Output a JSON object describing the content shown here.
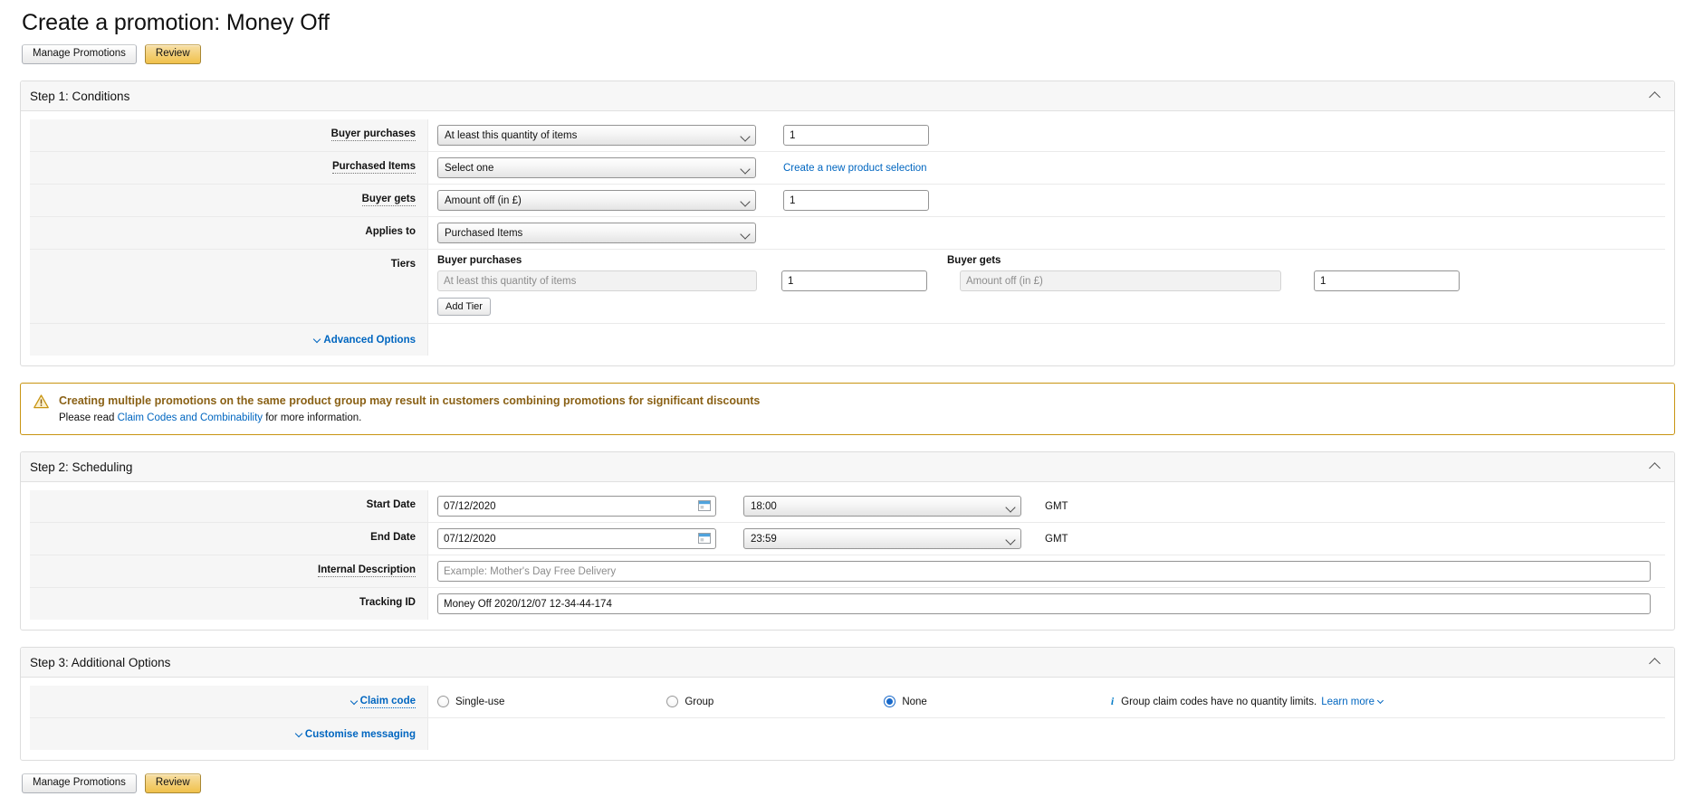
{
  "page": {
    "title": "Create a promotion: Money Off"
  },
  "toolbar": {
    "manage_label": "Manage Promotions",
    "review_label": "Review"
  },
  "step1": {
    "header": "Step 1: Conditions",
    "rows": {
      "buyer_purchases": {
        "label": "Buyer purchases",
        "select_value": "At least this quantity of items",
        "qty_value": "1"
      },
      "purchased_items": {
        "label": "Purchased Items",
        "select_value": "Select one",
        "link": "Create a new product selection"
      },
      "buyer_gets": {
        "label": "Buyer gets",
        "select_value": "Amount off (in £)",
        "qty_value": "1"
      },
      "applies_to": {
        "label": "Applies to",
        "select_value": "Purchased Items"
      },
      "tiers": {
        "label": "Tiers",
        "head_left": "Buyer purchases",
        "head_right": "Buyer gets",
        "left_placeholder": "At least this quantity of items",
        "left_qty": "1",
        "right_placeholder": "Amount off (in £)",
        "right_qty": "1",
        "add_tier_label": "Add Tier"
      },
      "advanced": {
        "label": "Advanced Options"
      }
    }
  },
  "warning": {
    "icon": "warning-triangle-icon",
    "title": "Creating multiple promotions on the same product group may result in customers combining promotions for significant discounts",
    "text_before": "Please read ",
    "link": "Claim Codes and Combinability",
    "text_after": " for more information."
  },
  "step2": {
    "header": "Step 2: Scheduling",
    "rows": {
      "start_date": {
        "label": "Start Date",
        "date_value": "07/12/2020",
        "time_value": "18:00",
        "timezone": "GMT"
      },
      "end_date": {
        "label": "End Date",
        "date_value": "07/12/2020",
        "time_value": "23:59",
        "timezone": "GMT"
      },
      "internal_description": {
        "label": "Internal Description",
        "placeholder": "Example: Mother's Day Free Delivery",
        "value": ""
      },
      "tracking_id": {
        "label": "Tracking ID",
        "value": "Money Off 2020/12/07 12-34-44-174"
      }
    }
  },
  "step3": {
    "header": "Step 3: Additional Options",
    "claim_code": {
      "label": "Claim code",
      "options": [
        {
          "label": "Single-use",
          "selected": false
        },
        {
          "label": "Group",
          "selected": false
        },
        {
          "label": "None",
          "selected": true
        }
      ],
      "hint": "Group claim codes have no quantity limits.",
      "learn_more": "Learn more"
    },
    "customise_messaging": {
      "label": "Customise messaging"
    }
  },
  "colors": {
    "link": "#0066c0",
    "primary_button": "#f0c14b",
    "warning_border": "#c89411",
    "warning_text": "#8a6116",
    "radio_selected": "#1768c9"
  }
}
